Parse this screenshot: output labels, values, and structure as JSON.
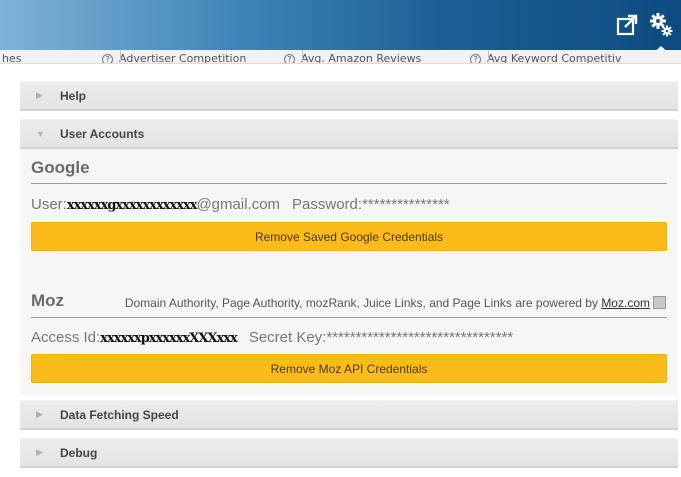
{
  "toolbar": {
    "open_icon": "external-link-icon",
    "settings_icon": "gear-icon",
    "banner_colors": [
      "#7fb2d6",
      "#1c5f96",
      "#0e4a80"
    ]
  },
  "columns": [
    {
      "label": "hes"
    },
    {
      "label": "Advertiser Competition"
    },
    {
      "label": "Avg. Amazon Reviews"
    },
    {
      "label": "Avg Keyword Competitiv"
    }
  ],
  "panel": {
    "help": {
      "label": "Help"
    },
    "user_accounts": {
      "label": "User Accounts"
    },
    "google": {
      "title": "Google",
      "user_label": "User:",
      "user_masked": "xxxxxxgxxxxxxxxxxxx",
      "user_domain": "@gmail.com",
      "password_label": "Password:",
      "password_value": "***************",
      "remove_button": "Remove Saved Google Credentials"
    },
    "moz": {
      "title": "Moz",
      "powered_text": "Domain Authority, Page Authority, mozRank, Juice Links, and Page Links are powered by ",
      "powered_link": "Moz.com",
      "access_label": "Access Id:",
      "access_masked": "xxxxxxpxxxxxxXXXxxx",
      "secret_label": "Secret Key:",
      "secret_value": "********************************",
      "remove_button": "Remove Moz API Credentials"
    },
    "data_fetching": {
      "label": "Data Fetching Speed"
    },
    "debug": {
      "label": "Debug"
    }
  },
  "colors": {
    "accent_button": "#fbbc18",
    "section_bg": "#f5f6f5"
  }
}
